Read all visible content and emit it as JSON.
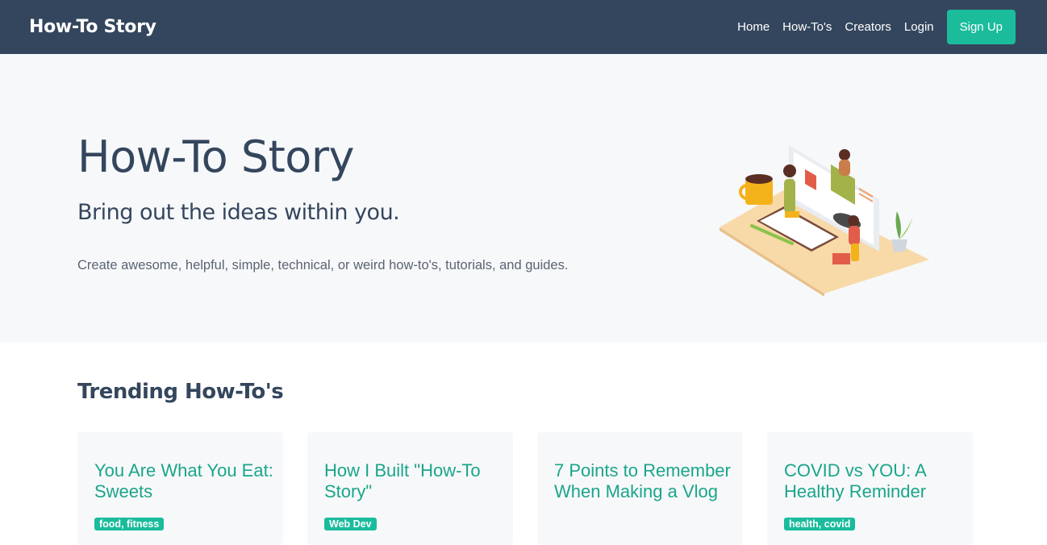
{
  "navbar": {
    "brand": "How-To Story",
    "links": [
      "Home",
      "How-To's",
      "Creators",
      "Login"
    ],
    "signup_label": "Sign Up"
  },
  "hero": {
    "title": "How-To Story",
    "subtitle": "Bring out the ideas within you.",
    "description": "Create awesome, helpful, simple, technical, or weird how-to's, tutorials, and guides."
  },
  "trending": {
    "heading": "Trending How-To's",
    "cards": [
      {
        "title": "You Are What You Eat: Sweets",
        "tag": "food, fitness"
      },
      {
        "title": "How I Built \"How-To Story\"",
        "tag": "Web Dev"
      },
      {
        "title": "7 Points to Remember When Making a Vlog",
        "tag": ""
      },
      {
        "title": "COVID vs YOU: A Healthy Reminder",
        "tag": "health, covid"
      }
    ]
  },
  "colors": {
    "navbar": "#34465d",
    "accent": "#1abc9c",
    "card_title": "#1aa58a",
    "hero_bg": "#f7f8fa"
  },
  "icons": {
    "hero_illustration": "desk-workspace-illustration"
  }
}
